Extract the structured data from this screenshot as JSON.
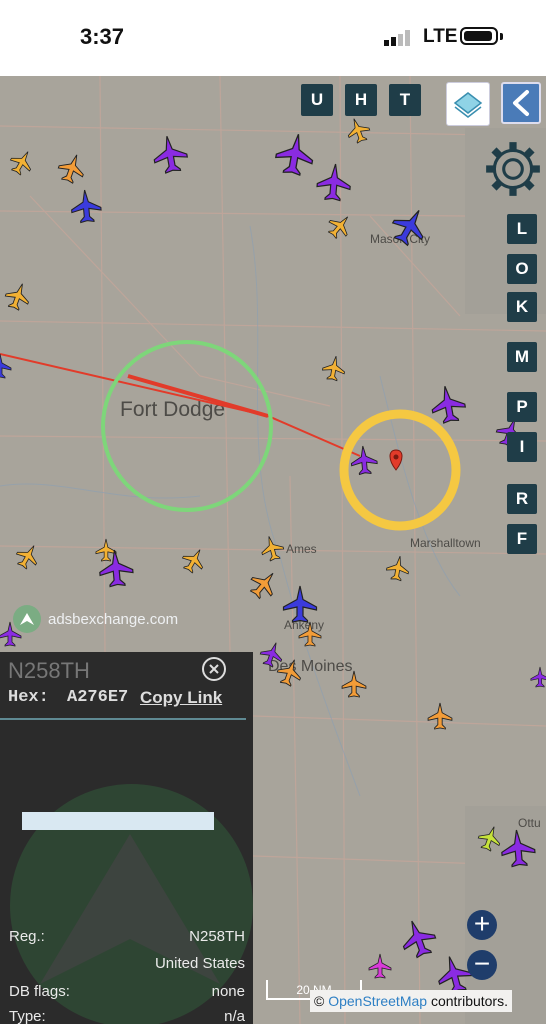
{
  "status": {
    "time": "3:37",
    "network": "LTE"
  },
  "toolbar": {
    "btn_u": "U",
    "btn_h": "H",
    "btn_t": "T"
  },
  "side_buttons": [
    "L",
    "O",
    "K",
    "M",
    "P",
    "I",
    "R",
    "F"
  ],
  "map": {
    "cities": [
      "Fort Dodge",
      "Mason City",
      "Ames",
      "Marshalltown",
      "Ankeny",
      "Des Moines",
      "Ottu"
    ],
    "watermark": "adsbexchange.com",
    "scale_label": "20 NM",
    "attribution_prefix": "©",
    "attribution_link": "OpenStreetMap",
    "attribution_suffix": "contributors."
  },
  "info": {
    "title": "N258TH",
    "hex_label": "Hex:",
    "hex_value": "A276E7",
    "copy_link": "Copy Link",
    "rows": [
      {
        "key": "Reg.:",
        "value": "N258TH"
      },
      {
        "key": "",
        "value": "United States"
      },
      {
        "key": "DB flags:",
        "value": "none"
      },
      {
        "key": "Type:",
        "value": "n/a"
      }
    ]
  },
  "colors": {
    "ring_green": "#7ed67a",
    "ring_yellow": "#f5c842",
    "track": "#e23b2a",
    "button": "#1f3d48",
    "map_bg": "#a8a49b"
  },
  "icons": [
    "signal-icon",
    "battery-icon",
    "layers-icon",
    "back-chevron-icon",
    "settings-gear-icon",
    "close-icon",
    "zoom-in-icon",
    "zoom-out-icon",
    "aircraft-icon",
    "location-pin-icon"
  ]
}
